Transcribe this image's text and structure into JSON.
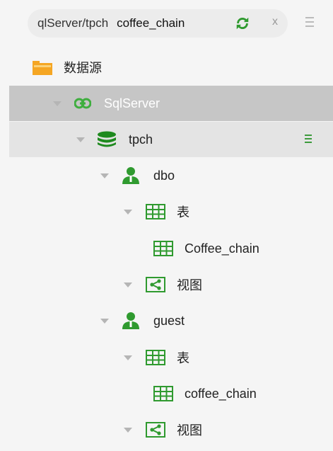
{
  "search": {
    "path": "qlServer/tpch",
    "value": "coffee_chain",
    "clear_symbol": "x"
  },
  "tree": {
    "root_label": "数据源",
    "connection_label": "SqlServer",
    "database_label": "tpch",
    "schemas": [
      {
        "label": "dbo",
        "tables_label": "表",
        "table_name": "Coffee_chain",
        "views_label": "视图"
      },
      {
        "label": "guest",
        "tables_label": "表",
        "table_name": "coffee_chain",
        "views_label": "视图"
      }
    ]
  },
  "colors": {
    "accent_green": "#2f9a2f",
    "folder_orange": "#f5a623",
    "selected_row": "#c6c6c6",
    "hover_row": "#e4e4e4"
  },
  "icons": [
    "refresh-icon",
    "clear-icon",
    "menu-icon",
    "folder-icon",
    "link-icon",
    "database-icon",
    "user-icon",
    "table-icon",
    "view-icon",
    "caret-down-icon"
  ]
}
